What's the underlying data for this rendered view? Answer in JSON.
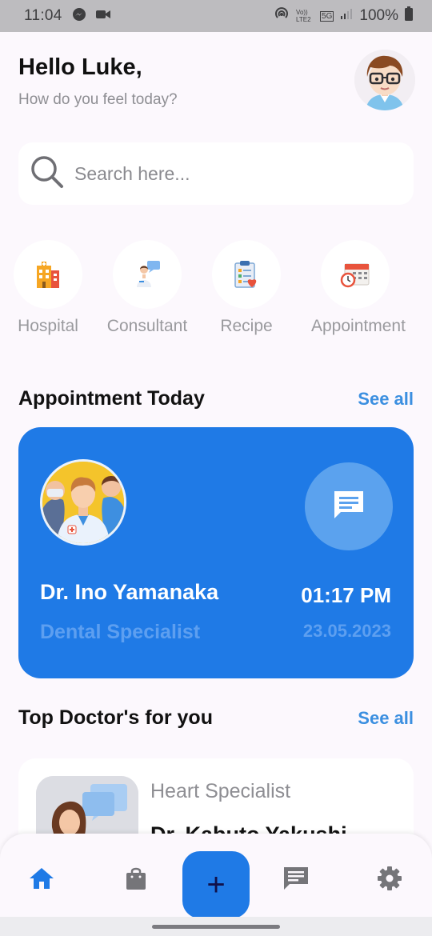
{
  "status_bar": {
    "time": "11:04",
    "battery": "100%",
    "network_badge": "5G",
    "volte_badge": "Vo)) LTE2"
  },
  "header": {
    "greeting": "Hello Luke,",
    "subtitle": "How do you feel today?"
  },
  "search": {
    "placeholder": "Search here..."
  },
  "categories": [
    {
      "label": "Hospital",
      "icon": "hospital-building-icon"
    },
    {
      "label": "Consultant",
      "icon": "consultant-doctor-icon"
    },
    {
      "label": "Recipe",
      "icon": "recipe-clipboard-icon"
    },
    {
      "label": "Appointment",
      "icon": "appointment-calendar-icon"
    }
  ],
  "appointment_section": {
    "title": "Appointment Today",
    "see_all": "See all",
    "card": {
      "doctor_name": "Dr. Ino Yamanaka",
      "specialty": "Dental Specialist",
      "time": "01:17 PM",
      "date": "23.05.2023"
    }
  },
  "top_doctors_section": {
    "title": "Top Doctor's for you",
    "see_all": "See all",
    "doctors": [
      {
        "specialty": "Heart Specialist",
        "name": "Dr. Kabuto Yakushi"
      }
    ]
  },
  "bottom_nav": {
    "items": [
      "home-icon",
      "shopping-bag-icon",
      "add-icon",
      "chat-icon",
      "settings-icon"
    ],
    "fab_symbol": "+"
  },
  "colors": {
    "accent": "#1f7ae6",
    "link": "#3b8fe0",
    "background": "#fcf8fd"
  }
}
